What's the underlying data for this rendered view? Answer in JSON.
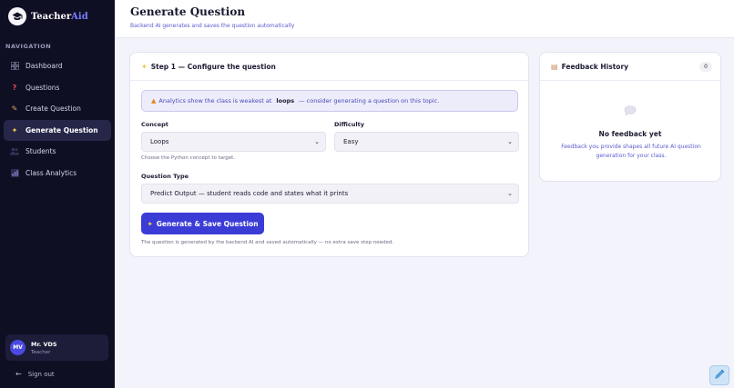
{
  "app": {
    "brand_main": "Teacher",
    "brand_accent": "Aid"
  },
  "sidebar": {
    "heading": "NAVIGATION",
    "items": [
      {
        "label": "Dashboard",
        "icon": "grid-icon"
      },
      {
        "label": "Questions",
        "icon": "question-icon"
      },
      {
        "label": "Create Question",
        "icon": "pencil-icon"
      },
      {
        "label": "Generate Question",
        "icon": "sparkle-icon",
        "active": true
      },
      {
        "label": "Students",
        "icon": "users-icon"
      },
      {
        "label": "Class Analytics",
        "icon": "chart-icon"
      }
    ],
    "user": {
      "initials": "MV",
      "name": "Mr. VDS",
      "role": "Teacher"
    },
    "signout": "Sign out"
  },
  "header": {
    "title": "Generate Question",
    "subtitle": "Backend AI generates and saves the question automatically"
  },
  "config": {
    "title": "Step 1 — Configure the question",
    "alert_pre": "Analytics show the class is weakest at",
    "alert_topic": "loops",
    "alert_post": "— consider generating a question on this topic.",
    "concept_label": "Concept",
    "concept_value": "Loops",
    "concept_hint": "Choose the Python concept to target.",
    "difficulty_label": "Difficulty",
    "difficulty_value": "Easy",
    "type_label": "Question Type",
    "type_value": "Predict Output — student reads code and states what it prints",
    "button_label": "Generate & Save Question",
    "footnote": "The question is generated by the backend AI and saved automatically — no extra save step needed."
  },
  "feedback": {
    "title": "Feedback History",
    "count": "0",
    "empty_title": "No feedback yet",
    "empty_text": "Feedback you provide shapes all future AI question generation for your class."
  },
  "colors": {
    "accent": "#3b3bd6",
    "sidebar_bg": "#0f0f24",
    "page_bg": "#f3f3fb"
  }
}
